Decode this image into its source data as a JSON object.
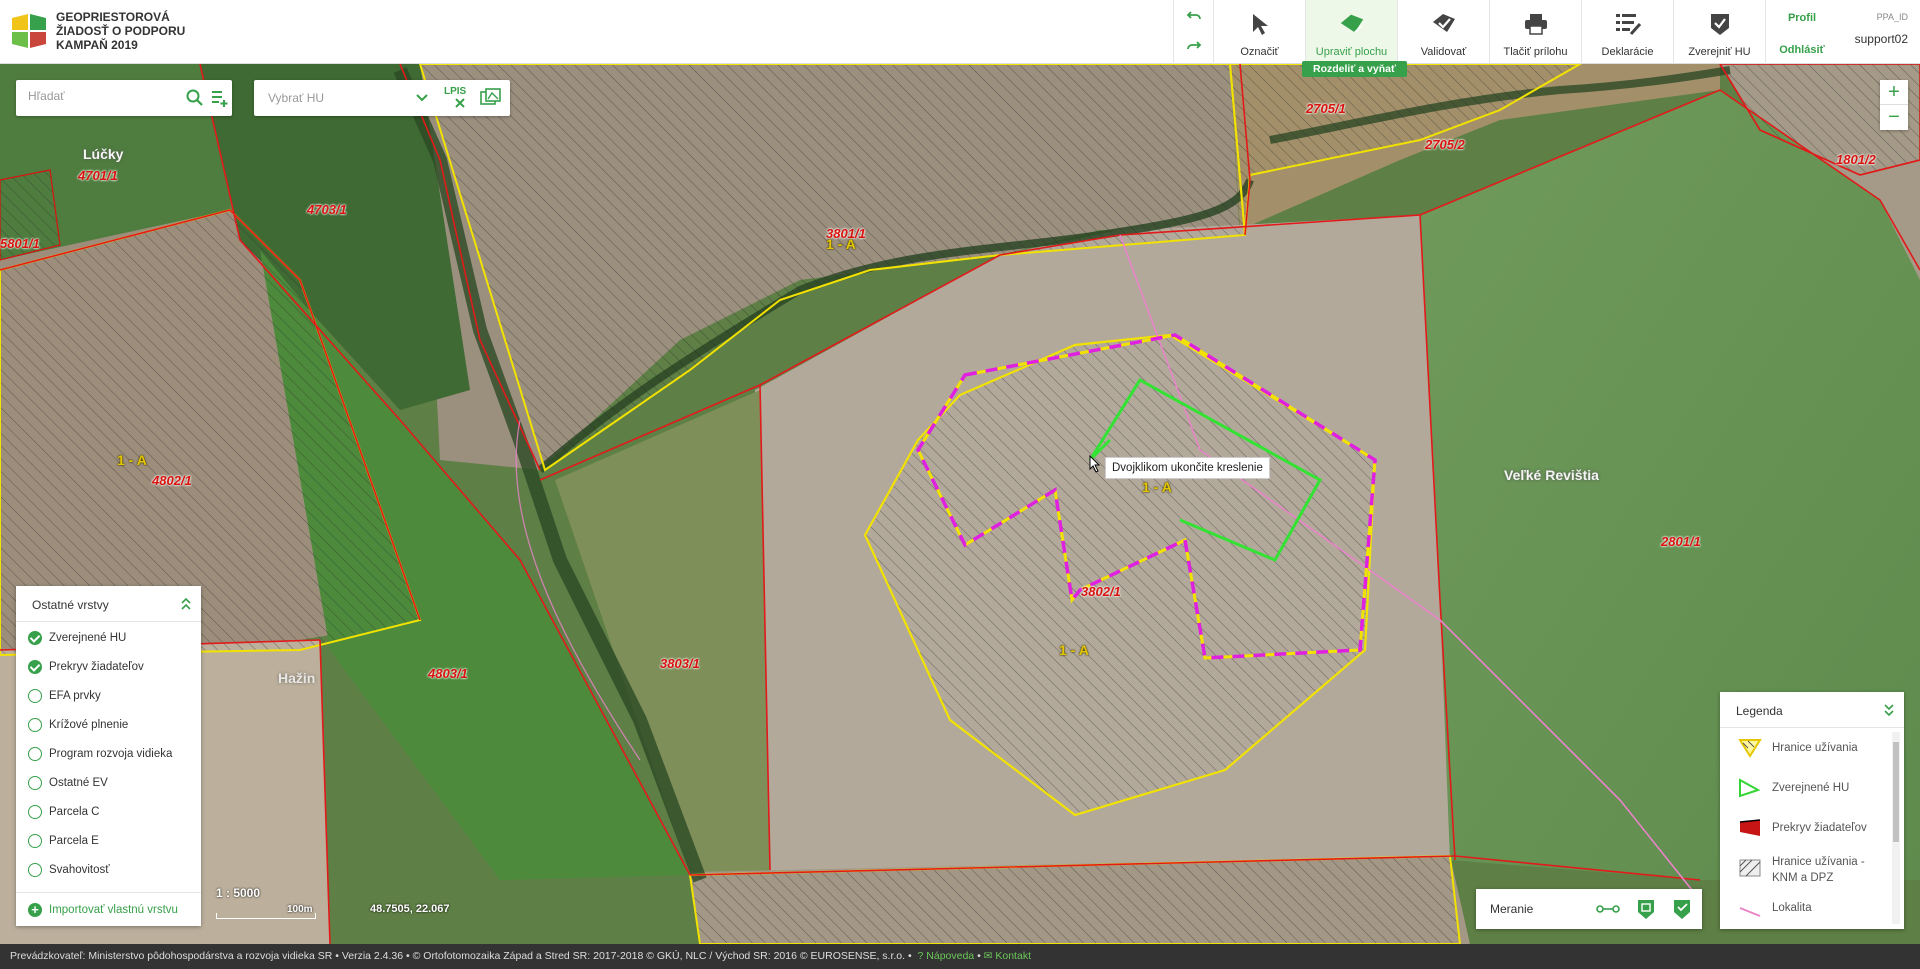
{
  "header": {
    "brand_lines": [
      "GEOPRIESTOROVÁ",
      "ŽIADOSŤ O PODPORU",
      "KAMPAŇ 2019"
    ],
    "tools": [
      {
        "label": "Označiť",
        "icon": "cursor-icon"
      },
      {
        "label": "Upraviť plochu",
        "icon": "edit-area-icon",
        "active": true
      },
      {
        "label": "Validovať",
        "icon": "validate-icon"
      },
      {
        "label": "Tlačiť prílohu",
        "icon": "print-icon"
      },
      {
        "label": "Deklarácie",
        "icon": "declarations-icon"
      },
      {
        "label": "Zverejniť HU",
        "icon": "publish-icon"
      }
    ],
    "sub_action": "Rozdeliť a vyňať",
    "profile": "Profil",
    "logout": "Odhlásiť",
    "user_id_label": "PPA_ID",
    "user_name": "support02",
    "accent_color": "#37a04a"
  },
  "search": {
    "placeholder": "Hľadať"
  },
  "hu_select": {
    "placeholder": "Vybrať HU",
    "lpis_label": "LPIS"
  },
  "tooltip": "Dvojklikom ukončite kreslenie",
  "layers": {
    "title": "Ostatné vrstvy",
    "items": [
      {
        "label": "Zverejnené HU",
        "checked": true
      },
      {
        "label": "Prekryv žiadateľov",
        "checked": true
      },
      {
        "label": "EFA prvky",
        "checked": false
      },
      {
        "label": "Krížové plnenie",
        "checked": false
      },
      {
        "label": "Program rozvoja vidieka",
        "checked": false
      },
      {
        "label": "Ostatné EV",
        "checked": false
      },
      {
        "label": "Parcela C",
        "checked": false
      },
      {
        "label": "Parcela E",
        "checked": false
      },
      {
        "label": "Svahovitosť",
        "checked": false
      }
    ],
    "import_label": "Importovať vlastnú vrstvu"
  },
  "legend": {
    "title": "Legenda",
    "items": [
      {
        "label": "Hranice užívania"
      },
      {
        "label": "Zverejnené HU"
      },
      {
        "label": "Prekryv žiadateľov"
      },
      {
        "label": "Hranice užívania - KNM a DPZ"
      },
      {
        "label": "Lokalita"
      }
    ]
  },
  "measure": {
    "label": "Meranie"
  },
  "scale": {
    "ratio": "1 : 5000",
    "bar_label": "100m"
  },
  "coords": "48.7505, 22.067",
  "map_labels": {
    "places": [
      "Lúčky",
      "Veľké Revištia",
      "Hažin"
    ],
    "parcels": [
      "4701/1",
      "4703/1",
      "5801/1",
      "3801/1",
      "2705/1",
      "2705/2",
      "1801/2",
      "4802/1",
      "2801/1",
      "3803/1",
      "4803/1",
      "3802/1"
    ],
    "hu": [
      "1 - A",
      "1 - A",
      "1 - A",
      "1 - A"
    ]
  },
  "footer": {
    "text": "Prevádzkovateľ: Ministerstvo pôdohospodárstva a rozvoja vidieka SR • Verzia 2.4.36 • © Ortofotomozaika Západ a Stred SR: 2017-2018 © GKÚ, NLC / Východ SR: 2016 © EUROSENSE, s.r.o. •",
    "help": "Nápoveda",
    "contact": "Kontakt"
  }
}
